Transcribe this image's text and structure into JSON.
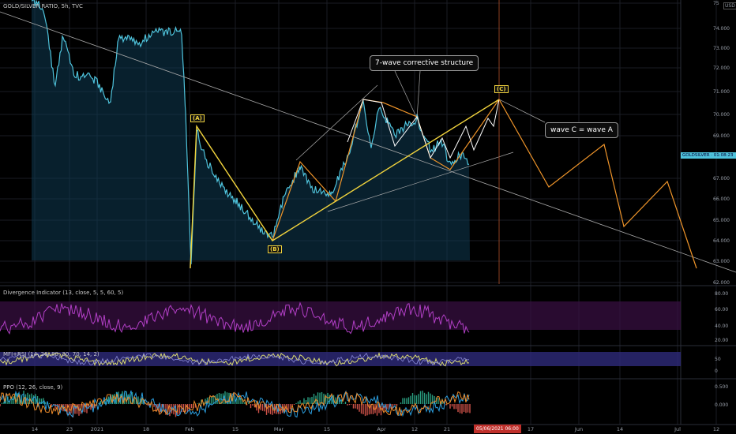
{
  "header": {
    "symbol_title": "GOLD/SILVER RATIO, 5h, TVC",
    "currency": "USD"
  },
  "price_axis": [
    "75",
    "74.000",
    "73.000",
    "72.000",
    "71.000",
    "70.000",
    "69.000",
    "67.000",
    "66.000",
    "65.000",
    "64.000",
    "63.000",
    "62.000"
  ],
  "price_tag": "GOLDSILVER  ·  01:08:23",
  "annotations": {
    "structure": "7-wave corrective structure",
    "equality": "wave C = wave A",
    "wave_a": "(A)",
    "wave_b": "(B)",
    "wave_c": "(C)"
  },
  "indicators": {
    "divergence": {
      "title": "Divergence Indicator (13, close, 5, 5, 60, 5)",
      "axis": [
        "80.00",
        "60.00",
        "40.00",
        "20.00"
      ]
    },
    "mfi_rsi": {
      "title": "MFI+RSI (14, 20, 80, 30, 70, 14, 2)",
      "axis": [
        "50",
        "0"
      ]
    },
    "ppo": {
      "title": "PPO (12, 26, close, 9)",
      "axis": [
        "0.500",
        "0.000"
      ]
    }
  },
  "time_axis": [
    "14",
    "23",
    "2021",
    "18",
    "Feb",
    "15",
    "Mar",
    "15",
    "Apr",
    "12",
    "21",
    "17",
    "Jun",
    "14",
    "Jul",
    "12"
  ],
  "cursor_time": "05/06/2021  06:00",
  "colors": {
    "price": "#4fc3dc",
    "wave": "#f2d43d",
    "projection": "#f0952a",
    "divergence": "#b23fc6",
    "cursor": "#d0392b"
  }
}
